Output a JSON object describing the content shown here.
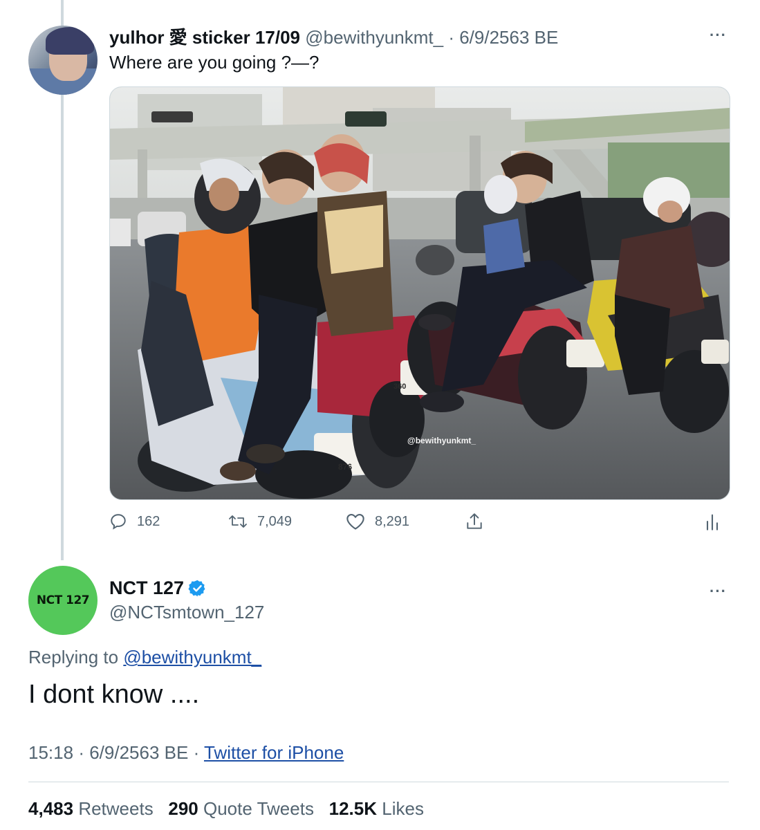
{
  "tweet1": {
    "display_name": "yulhor 愛 sticker 17/09",
    "handle": "@bewithyunkmt_",
    "separator": "·",
    "date": "6/9/2563 BE",
    "text": "Where are you going ?—?",
    "more": "···",
    "image_watermark": "@bewithyunkmt_",
    "plate_1": "360",
    "plate_2": "876",
    "actions": {
      "replies": "162",
      "retweets": "7,049",
      "likes": "8,291"
    }
  },
  "tweet2": {
    "display_name": "NCT 127",
    "avatar_text": "NCT 127",
    "handle": "@NCTsmtown_127",
    "replying_prefix": "Replying to",
    "replying_handle": "@bewithyunkmt_",
    "text": "I dont know ....",
    "time": "15:18",
    "date": "6/9/2563 BE",
    "source": "Twitter for iPhone",
    "more": "···",
    "stats": {
      "retweets_value": "4,483",
      "retweets_label": "Retweets",
      "quotes_value": "290",
      "quotes_label": "Quote Tweets",
      "likes_value": "12.5K",
      "likes_label": "Likes"
    }
  },
  "colors": {
    "verified": "#1d9bf0",
    "avatar_green": "#54c85a",
    "link": "#1d4fa5",
    "muted": "#536471"
  }
}
